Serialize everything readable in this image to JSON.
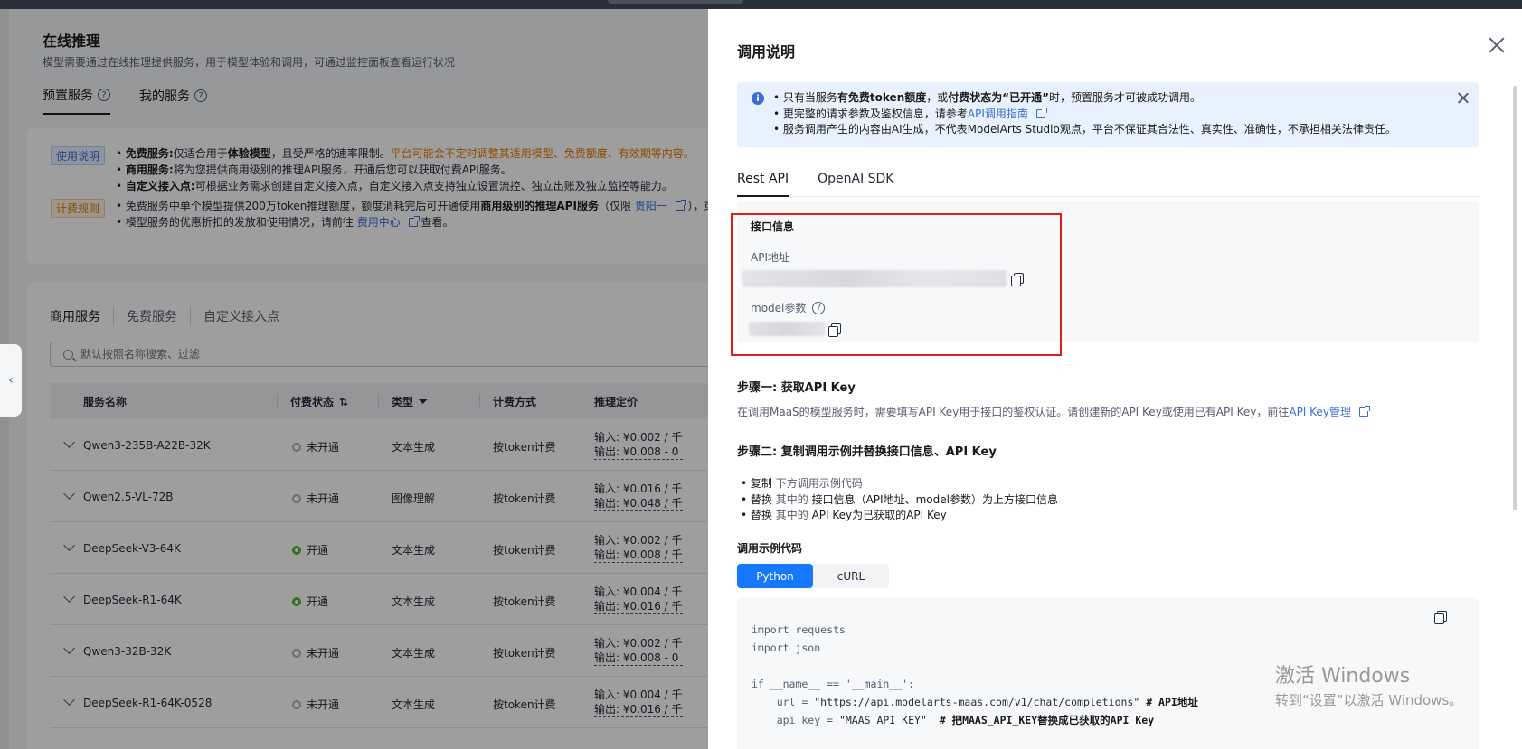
{
  "background_page": {
    "title": "在线推理",
    "subtitle": "模型需要通过在线推理提供服务，用于模型体验和调用，可通过监控面板查看运行状况",
    "top_tabs": [
      {
        "label": "预置服务",
        "help": "?"
      },
      {
        "label": "我的服务",
        "help": "?"
      }
    ],
    "usage_tag": "使用说明",
    "usage_lines": {
      "free_label": "免费服务:",
      "free_a": "仅适合用于",
      "free_b": "体验模型",
      "free_c": "，且受严格的速率限制。",
      "free_warn": "平台可能会不定时调整其适用模型、免费额度、有效期等内容。",
      "biz_label": "商用服务:",
      "biz_text": "将为您提供商用级别的推理API服务，开通后您可以获取付费API服务。",
      "custom_label": "自定义接入点:",
      "custom_text": "可根据业务需求创建自定义接入点，自定义接入点支持独立设置流控、独立出账及独立监控等能力。"
    },
    "billing_tag": "计费规则",
    "billing_lines": {
      "line1_a": "免费服务中单个模型提供200万token推理额度，额度消耗完后可开通使用",
      "line1_b": "商用级别的推理API服务",
      "line1_c": "（仅限",
      "line1_link": "贵阳一",
      "line1_d": "），或",
      "line2_a": "模型服务的优惠折扣的发放和使用情况，请前往",
      "line2_link": "费用中心",
      "line2_b": "查看。"
    },
    "sub_tabs": [
      "商用服务",
      "免费服务",
      "自定义接入点"
    ],
    "search_placeholder": "默认按照名称搜索、过滤",
    "table_headers": {
      "name": "服务名称",
      "status": "付费状态",
      "type": "类型",
      "billing": "计费方式",
      "price": "推理定价"
    },
    "rows": [
      {
        "name": "Qwen3-235B-A22B-32K",
        "status": "未开通",
        "on": false,
        "type": "文本生成",
        "billing": "按token计费",
        "in": "输入: ¥0.002 / 千",
        "out": "输出: ¥0.008 - 0"
      },
      {
        "name": "Qwen2.5-VL-72B",
        "status": "未开通",
        "on": false,
        "type": "图像理解",
        "billing": "按token计费",
        "in": "输入: ¥0.016 / 千",
        "out": "输出: ¥0.048 / 千"
      },
      {
        "name": "DeepSeek-V3-64K",
        "status": "开通",
        "on": true,
        "type": "文本生成",
        "billing": "按token计费",
        "in": "输入: ¥0.002 / 千",
        "out": "输出: ¥0.008 / 千"
      },
      {
        "name": "DeepSeek-R1-64K",
        "status": "开通",
        "on": true,
        "type": "文本生成",
        "billing": "按token计费",
        "in": "输入: ¥0.004 / 千",
        "out": "输出: ¥0.016 / 千"
      },
      {
        "name": "Qwen3-32B-32K",
        "status": "未开通",
        "on": false,
        "type": "文本生成",
        "billing": "按token计费",
        "in": "输入: ¥0.002 / 千",
        "out": "输出: ¥0.008 - 0"
      },
      {
        "name": "DeepSeek-R1-64K-0528",
        "status": "未开通",
        "on": false,
        "type": "文本生成",
        "billing": "按token计费",
        "in": "输入: ¥0.004 / 千",
        "out": "输出: ¥0.016 / 千"
      }
    ],
    "collapse_handle": "‹"
  },
  "drawer": {
    "title": "调用说明",
    "notice": {
      "l1_a": "只有当服务",
      "l1_b": "有免费token额度",
      "l1_c": "，或",
      "l1_d": "付费状态为“已开通”",
      "l1_e": "时，预置服务才可被成功调用。",
      "l2_a": "更完整的请求参数及鉴权信息，请参考",
      "l2_link": "API调用指南",
      "l3": "服务调用产生的内容由AI生成，不代表ModelArts Studio观点，平台不保证其合法性、真实性、准确性，不承担相关法律责任。"
    },
    "api_tabs": [
      "Rest API",
      "OpenAI SDK"
    ],
    "interface": {
      "title": "接口信息",
      "api_addr_label": "API地址",
      "model_label": "model参数",
      "model_help": "?"
    },
    "step1": {
      "title": "步骤一: 获取API Key",
      "desc": "在调用MaaS的模型服务时，需要填写API Key用于接口的鉴权认证。请创建新的API Key或使用已有API Key，前往",
      "link": "API Key管理"
    },
    "step2": {
      "title": "步骤二: 复制调用示例并替换接口信息、API Key",
      "b1_a": "复制",
      "b1_b": "下方调用示例代码",
      "b2_a": "替换",
      "b2_b": "其中的",
      "b2_c": "接口信息（API地址、model参数）为上方接口信息",
      "b3_a": "替换",
      "b3_b": "其中的",
      "b3_c": "API Key为已获取的API Key"
    },
    "code_label": "调用示例代码",
    "code_tabs": [
      "Python",
      "cURL"
    ],
    "code_lines": {
      "l1": "import requests",
      "l2": "import json",
      "l3": "if __name__ == '__main__':",
      "l4_a": "    url = ",
      "l4_b": "\"https://api.modelarts-maas.com/v1/chat/completions\"",
      "l4_c": " # API地址",
      "l5_a": "    api_key = ",
      "l5_b": "\"MAAS_API_KEY\"",
      "l5_c": "  # 把MAAS_API_KEY替换成已获取的API Key"
    }
  },
  "watermark": {
    "line1": "激活 Windows",
    "line2": "转到“设置”以激活 Windows。"
  }
}
